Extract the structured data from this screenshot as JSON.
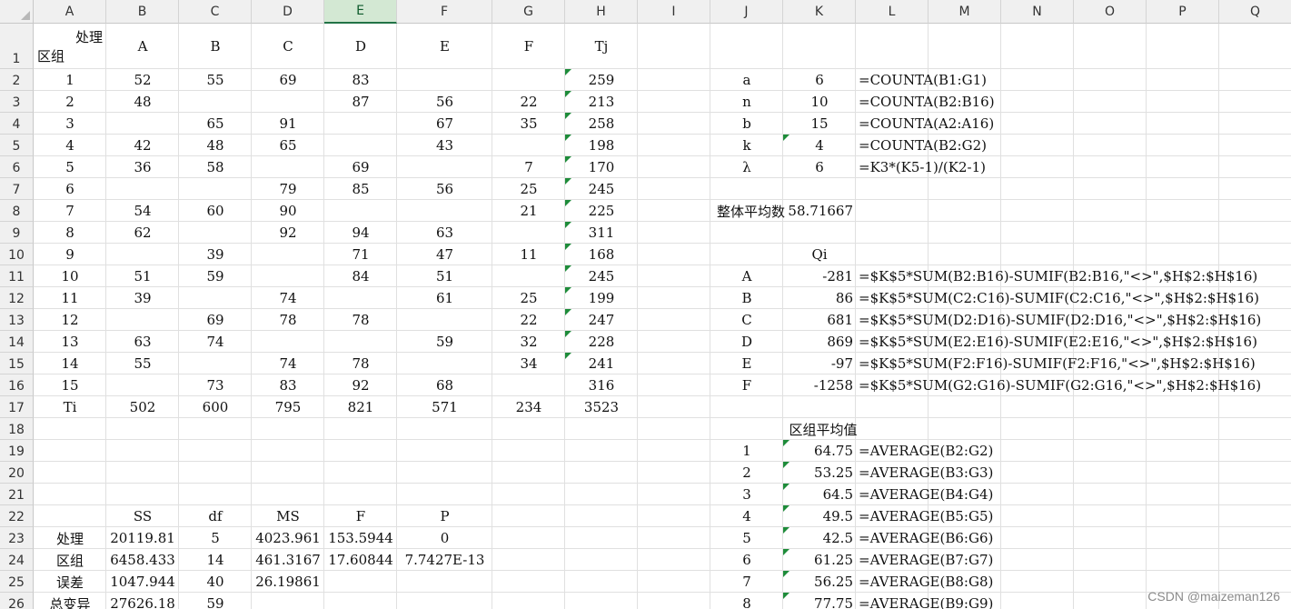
{
  "columns": [
    "A",
    "B",
    "C",
    "D",
    "E",
    "F",
    "G",
    "H",
    "I",
    "J",
    "K",
    "L",
    "M",
    "N",
    "O",
    "P",
    "Q"
  ],
  "selected_column": "E",
  "rows": [
    "1",
    "2",
    "3",
    "4",
    "5",
    "6",
    "7",
    "8",
    "9",
    "10",
    "11",
    "12",
    "13",
    "14",
    "15",
    "16",
    "17",
    "18",
    "19",
    "20",
    "21",
    "22",
    "23",
    "24",
    "25",
    "26"
  ],
  "cells": {
    "A1a": "处理",
    "A1b": "区组",
    "B1": "A",
    "C1": "B",
    "D1": "C",
    "E1": "D",
    "F1": "E",
    "G1": "F",
    "H1": "Tj",
    "A2": "1",
    "B2": "52",
    "C2": "55",
    "D2": "69",
    "E2": "83",
    "H2": "259",
    "A3": "2",
    "B3": "48",
    "E3": "87",
    "F3": "56",
    "G3": "22",
    "H3": "213",
    "A4": "3",
    "C4": "65",
    "D4": "91",
    "F4": "67",
    "G4": "35",
    "H4": "258",
    "A5": "4",
    "B5": "42",
    "C5": "48",
    "D5": "65",
    "F5": "43",
    "H5": "198",
    "A6": "5",
    "B6": "36",
    "C6": "58",
    "E6": "69",
    "G6": "7",
    "H6": "170",
    "A7": "6",
    "D7": "79",
    "E7": "85",
    "F7": "56",
    "G7": "25",
    "H7": "245",
    "A8": "7",
    "B8": "54",
    "C8": "60",
    "D8": "90",
    "G8": "21",
    "H8": "225",
    "A9": "8",
    "B9": "62",
    "D9": "92",
    "E9": "94",
    "F9": "63",
    "H9": "311",
    "A10": "9",
    "C10": "39",
    "E10": "71",
    "F10": "47",
    "G10": "11",
    "H10": "168",
    "A11": "10",
    "B11": "51",
    "C11": "59",
    "E11": "84",
    "F11": "51",
    "H11": "245",
    "A12": "11",
    "B12": "39",
    "D12": "74",
    "F12": "61",
    "G12": "25",
    "H12": "199",
    "A13": "12",
    "C13": "69",
    "D13": "78",
    "E13": "78",
    "G13": "22",
    "H13": "247",
    "A14": "13",
    "B14": "63",
    "C14": "74",
    "F14": "59",
    "G14": "32",
    "H14": "228",
    "A15": "14",
    "B15": "55",
    "D15": "74",
    "E15": "78",
    "G15": "34",
    "H15": "241",
    "A16": "15",
    "C16": "73",
    "D16": "83",
    "E16": "92",
    "F16": "68",
    "H16": "316",
    "A17": "Ti",
    "B17": "502",
    "C17": "600",
    "D17": "795",
    "E17": "821",
    "F17": "571",
    "G17": "234",
    "H17": "3523",
    "B22": "SS",
    "C22": "df",
    "D22": "MS",
    "E22": "F",
    "F22": "P",
    "A23": "处理",
    "B23": "20119.81",
    "C23": "5",
    "D23": "4023.961",
    "E23": "153.5944",
    "F23": "0",
    "A24": "区组",
    "B24": "6458.433",
    "C24": "14",
    "D24": "461.3167",
    "E24": "17.60844",
    "F24": "7.7427E-13",
    "A25": "误差",
    "B25": "1047.944",
    "C25": "40",
    "D25": "26.19861",
    "A26": "总变异",
    "B26": "27626.18",
    "C26": "59",
    "J2": "a",
    "K2": "6",
    "L2": "=COUNTA(B1:G1)",
    "J3": "n",
    "K3": "10",
    "L3": "=COUNTA(B2:B16)",
    "J4": "b",
    "K4": "15",
    "L4": "=COUNTA(A2:A16)",
    "J5": "k",
    "K5": "4",
    "L5": "=COUNTA(B2:G2)",
    "J6": "λ",
    "K6": "6",
    "L6": "=K3*(K5-1)/(K2-1)",
    "J8": "整体平均数",
    "K8": "58.71667",
    "K10": "Qi",
    "J11": "A",
    "K11": "-281",
    "L11": "=$K$5*SUM(B2:B16)-SUMIF(B2:B16,\"<>\",$H$2:$H$16)",
    "J12": "B",
    "K12": "86",
    "L12": "=$K$5*SUM(C2:C16)-SUMIF(C2:C16,\"<>\",$H$2:$H$16)",
    "J13": "C",
    "K13": "681",
    "L13": "=$K$5*SUM(D2:D16)-SUMIF(D2:D16,\"<>\",$H$2:$H$16)",
    "J14": "D",
    "K14": "869",
    "L14": "=$K$5*SUM(E2:E16)-SUMIF(E2:E16,\"<>\",$H$2:$H$16)",
    "J15": "E",
    "K15": "-97",
    "L15": "=$K$5*SUM(F2:F16)-SUMIF(F2:F16,\"<>\",$H$2:$H$16)",
    "J16": "F",
    "K16": "-1258",
    "L16": "=$K$5*SUM(G2:G16)-SUMIF(G2:G16,\"<>\",$H$2:$H$16)",
    "K18": "区组平均值",
    "J19": "1",
    "K19": "64.75",
    "L19": "=AVERAGE(B2:G2)",
    "J20": "2",
    "K20": "53.25",
    "L20": "=AVERAGE(B3:G3)",
    "J21": "3",
    "K21": "64.5",
    "L21": "=AVERAGE(B4:G4)",
    "J22": "4",
    "K22": "49.5",
    "L22": "=AVERAGE(B5:G5)",
    "J23": "5",
    "K23": "42.5",
    "L23": "=AVERAGE(B6:G6)",
    "J24": "6",
    "K24": "61.25",
    "L24": "=AVERAGE(B7:G7)",
    "J25": "7",
    "K25": "56.25",
    "L25": "=AVERAGE(B8:G8)",
    "J26": "8",
    "K26": "77.75",
    "L26": "=AVERAGE(B9:G9)"
  },
  "watermark": "CSDN @maizeman126"
}
